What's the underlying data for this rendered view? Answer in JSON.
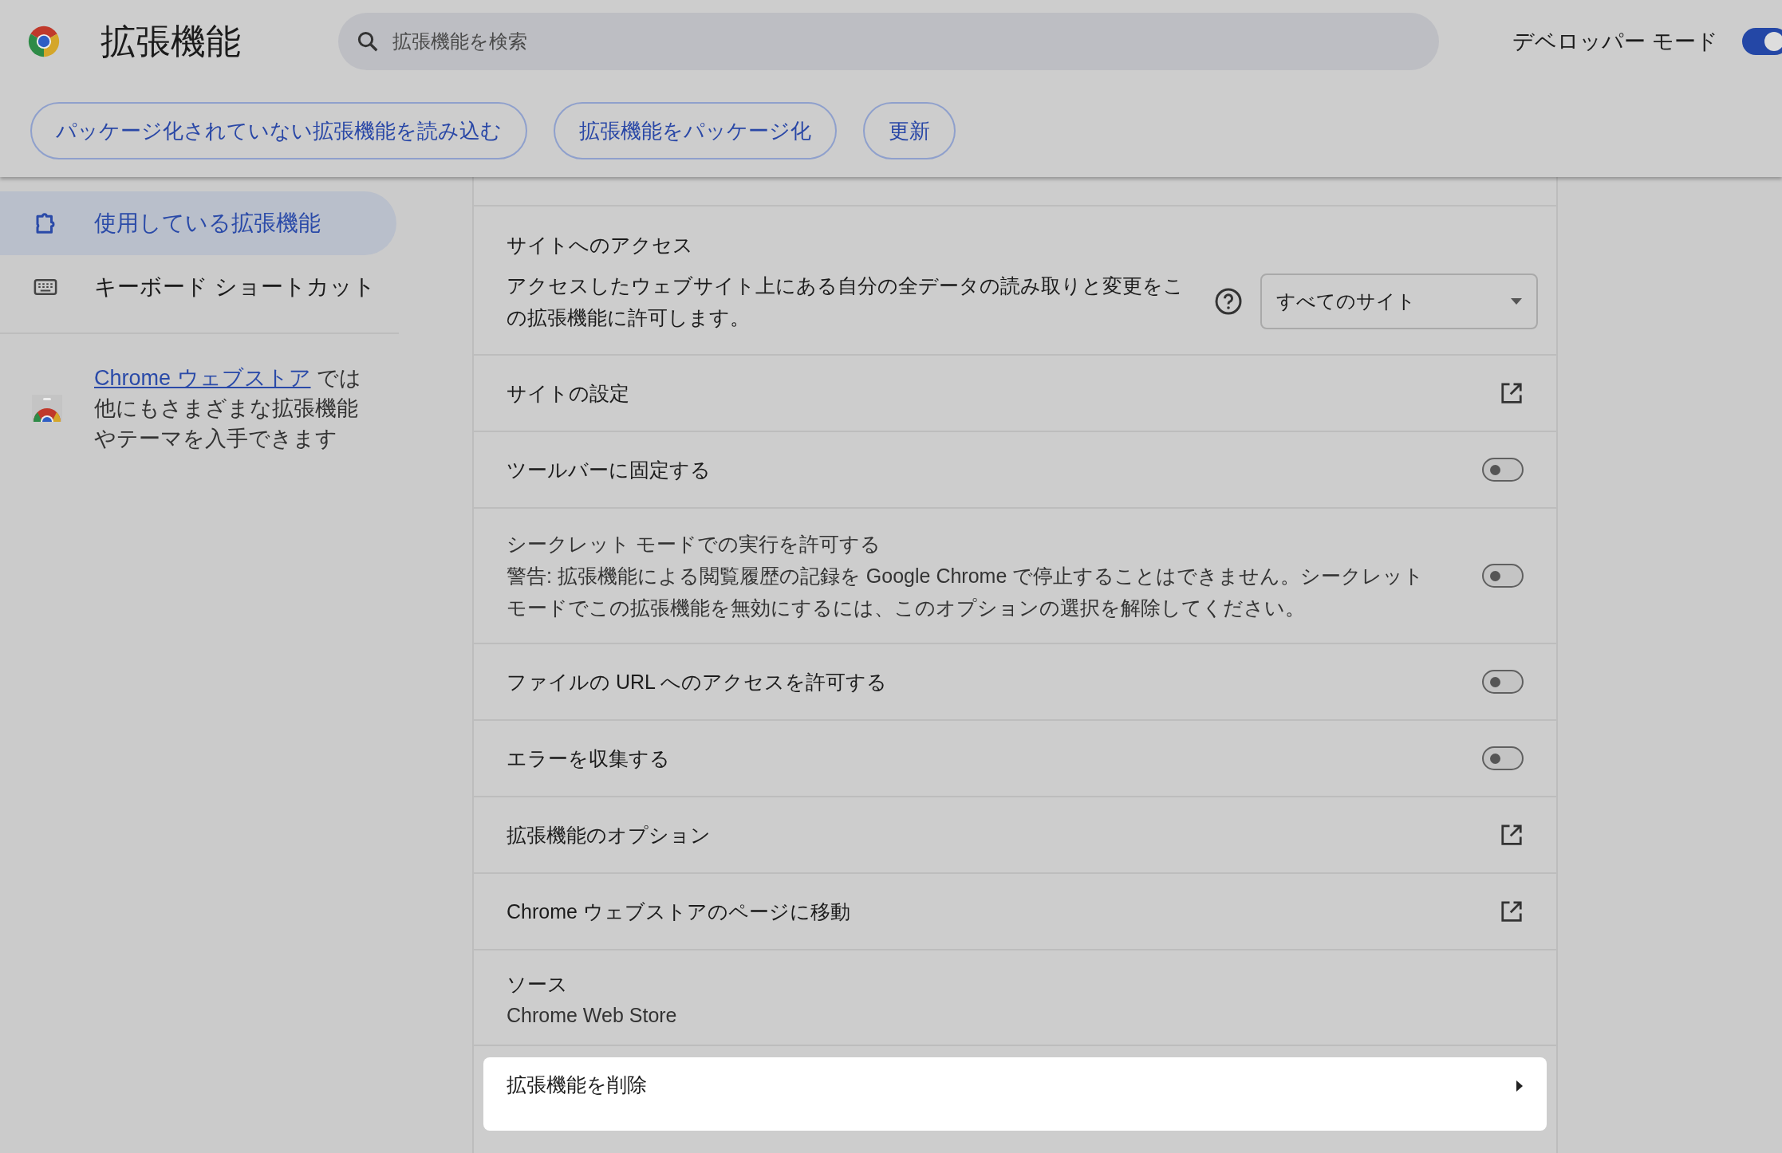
{
  "header": {
    "title": "拡張機能",
    "search": {
      "placeholder": "拡張機能を検索"
    },
    "developer_mode": {
      "label": "デベロッパー モード",
      "on": true
    }
  },
  "toolbar_buttons": [
    "パッケージ化されていない拡張機能を読み込む",
    "拡張機能をパッケージ化",
    "更新"
  ],
  "sidebar": {
    "items": [
      {
        "kind": "extensions",
        "label": "使用している拡張機能",
        "selected": true
      },
      {
        "kind": "shortcuts",
        "label": "キーボード ショートカット",
        "selected": false
      }
    ],
    "store_promo": {
      "link": "Chrome ウェブストア",
      "text": " では他にもさまざまな拡張機能やテーマを入手できます"
    }
  },
  "details": {
    "rows": [
      {
        "kind": "access",
        "title": "サイトへのアクセス",
        "description": "アクセスしたウェブサイト上にある自分の全データの読み取りと変更をこの拡張機能に許可します。",
        "dropdown": "すべてのサイト",
        "highlighted": false
      },
      {
        "kind": "link",
        "label": "サイトの設定",
        "highlighted": false
      },
      {
        "kind": "toggle",
        "label": "ツールバーに固定する",
        "on": false,
        "highlighted": false
      },
      {
        "kind": "toggle",
        "label": "シークレット モードでの実行を許可する",
        "description": "警告: 拡張機能による閲覧履歴の記録を Google Chrome で停止することはできません。シークレットモードでこの拡張機能を無効にするには、このオプションの選択を解除してください。",
        "on": false,
        "highlighted": false
      },
      {
        "kind": "toggle",
        "label": "ファイルの URL へのアクセスを許可する",
        "on": false,
        "highlighted": false
      },
      {
        "kind": "toggle",
        "label": "エラーを収集する",
        "on": false,
        "highlighted": false
      },
      {
        "kind": "link",
        "label": "拡張機能のオプション",
        "highlighted": false
      },
      {
        "kind": "link",
        "label": "Chrome ウェブストアのページに移動",
        "highlighted": false
      },
      {
        "kind": "info",
        "label": "ソース",
        "value": "Chrome Web Store",
        "highlighted": false
      },
      {
        "kind": "action",
        "label": "拡張機能を削除",
        "highlighted": true
      }
    ]
  }
}
